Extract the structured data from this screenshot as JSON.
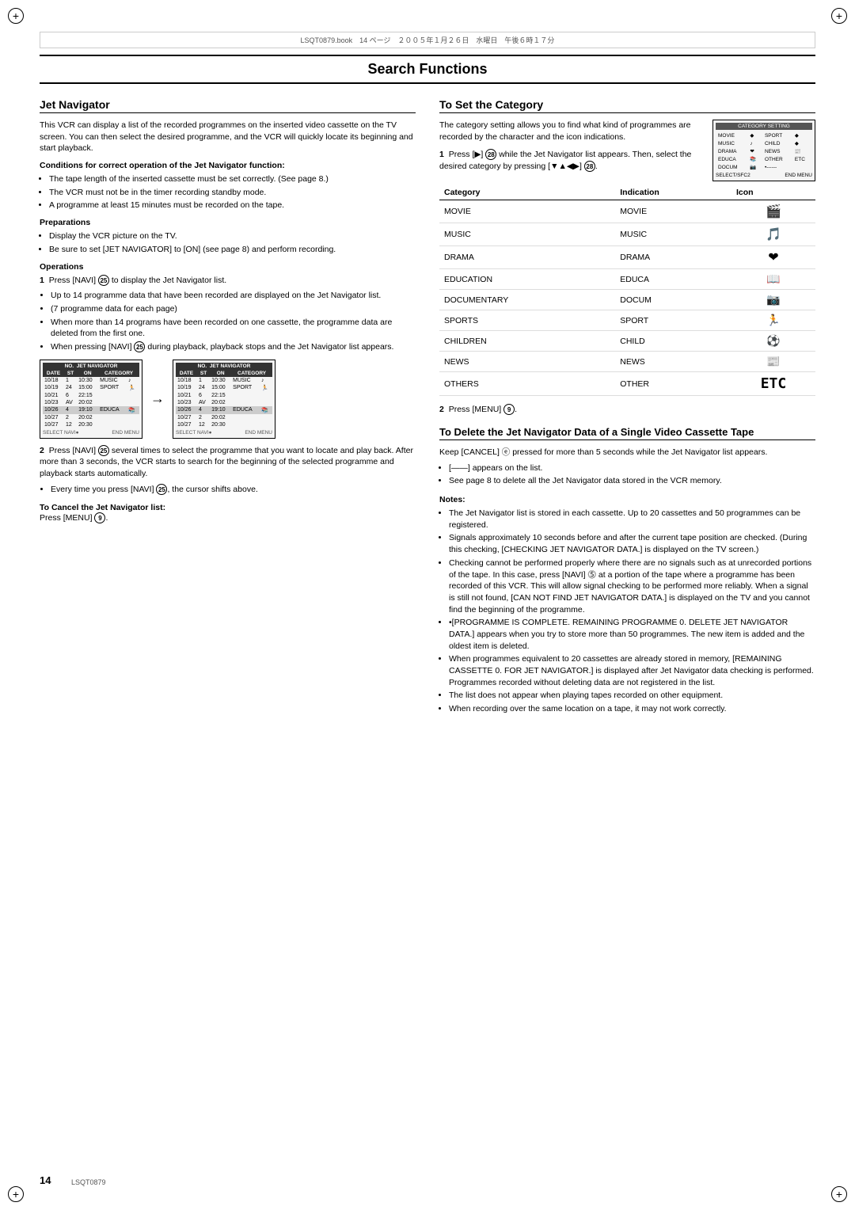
{
  "meta": {
    "file_info": "LSQT0879.book　14 ページ　２００５年１月２６日　水曜日　午後６時１７分",
    "page_number": "14",
    "lsqt": "LSQT0879"
  },
  "main_title": "Search Functions",
  "left_col": {
    "jet_nav_title": "Jet Navigator",
    "jet_nav_intro": "This VCR can display a list of the recorded programmes on the inserted video cassette on the TV screen. You can then select the desired programme, and the VCR will quickly locate its beginning and start playback.",
    "conditions_heading": "Conditions for correct operation of the Jet Navigator function:",
    "conditions": [
      "The tape length of the inserted cassette must be set correctly. (See page 8.)",
      "The VCR must not be in the timer recording standby mode.",
      "A programme at least 15 minutes must be recorded on the tape."
    ],
    "preparations_heading": "Preparations",
    "preparations": [
      "Display the VCR picture on the TV.",
      "Be sure to set [JET NAVIGATOR] to [ON] (see page 8) and perform recording."
    ],
    "operations_heading": "Operations",
    "step1_text": "Press [NAVI] ⓹ to display the Jet Navigator list.",
    "step1_bullets": [
      "Up to 14 programme data that have been recorded are displayed on the Jet Navigator list.",
      "(7 programme data for each page)",
      "When more than 14 programs have been recorded on one cassette, the programme data are deleted from the first one.",
      "When pressing [NAVI] ⓹ during playback, playback stops and the Jet Navigator list appears."
    ],
    "step2_text": "Press [NAVI] ⓹ several times to select the programme that you want to locate and play back. After more than 3 seconds, the VCR starts to search for the beginning of the selected programme and playback starts automatically.",
    "step2_bullets": [
      "Every time you press [NAVI] ⓹, the cursor shifts above."
    ],
    "nav_table_cols": [
      "NO.",
      "JET NAVIGATOR",
      "DATE",
      "ST",
      "ON",
      "CATEGORY"
    ],
    "nav_rows_1": [
      [
        "10/18",
        "1",
        "10:30",
        "MUSIC",
        "♪"
      ],
      [
        "10/19",
        "24",
        "15:00",
        "SPORT",
        "⚽"
      ],
      [
        "10/21",
        "6",
        "22:15",
        ""
      ],
      [
        "10/23",
        "AV",
        "20:02",
        ""
      ],
      [
        "10/26",
        "4",
        "19:10",
        "EDUCA",
        "📚"
      ],
      [
        "10/27",
        "2",
        "20:02",
        ""
      ],
      [
        "10/27",
        "12",
        "20:30",
        ""
      ]
    ],
    "nav_rows_2": [
      [
        "10/18",
        "1",
        "10:30",
        "MUSIC",
        "♪"
      ],
      [
        "10/19",
        "24",
        "15:00",
        "SPORT",
        "⚽"
      ],
      [
        "10/21",
        "6",
        "22:15",
        ""
      ],
      [
        "10/23",
        "AV",
        "20:02",
        ""
      ],
      [
        "10/26",
        "4",
        "19:10",
        "EDUCA",
        "📚"
      ],
      [
        "10/27",
        "2",
        "20:02",
        ""
      ],
      [
        "10/27",
        "12",
        "20:30",
        ""
      ]
    ],
    "cancel_heading": "To Cancel the Jet Navigator list:",
    "cancel_text": "Press [MENU] ⓞ."
  },
  "right_col": {
    "category_title": "To Set the Category",
    "category_intro": "The category setting allows you to find what kind of programmes are recorded by the character and the icon indications.",
    "step1_text": "Press [►] ⓜ while the Jet Navigator list appears. Then, select the desired category by pressing [▼▲◄►] ⓜ.",
    "category_screen": {
      "title": "CATEGORY SETTING",
      "items_col1": [
        "MOVIE",
        "MUSIC",
        "DRAMA",
        "EDUCA",
        "DOCUM"
      ],
      "items_col2": [
        "SPORT",
        "CHILD",
        "NEWS",
        "OTHER",
        "•------"
      ]
    },
    "cat_table_headers": [
      "Category",
      "Indication",
      "Icon"
    ],
    "cat_table_rows": [
      {
        "category": "MOVIE",
        "indication": "MOVIE",
        "icon": "🎬"
      },
      {
        "category": "MUSIC",
        "indication": "MUSIC",
        "icon": "🎵"
      },
      {
        "category": "DRAMA",
        "indication": "DRAMA",
        "icon": "❤"
      },
      {
        "category": "EDUCATION",
        "indication": "EDUCA",
        "icon": "📖"
      },
      {
        "category": "DOCUMENTARY",
        "indication": "DOCUM",
        "icon": "📷"
      },
      {
        "category": "SPORTS",
        "indication": "SPORT",
        "icon": "🏃"
      },
      {
        "category": "CHILDREN",
        "indication": "CHILD",
        "icon": "⚽"
      },
      {
        "category": "NEWS",
        "indication": "NEWS",
        "icon": "📰"
      },
      {
        "category": "OTHERS",
        "indication": "OTHER",
        "icon": "ETC"
      }
    ],
    "step2_text": "Press [MENU] ⓞ.",
    "delete_title": "To Delete the Jet Navigator Data of a Single Video Cassette Tape",
    "delete_intro": "Keep [CANCEL] ⓔ pressed for more than 5 seconds while the Jet Navigator list appears.",
    "delete_bullet1": "[——] appears on the list.",
    "delete_bullet2": "See page 8 to delete all the Jet Navigator data stored in the VCR memory.",
    "notes_heading": "Notes:",
    "notes": [
      "The Jet Navigator list is stored in each cassette. Up to 20 cassettes and 50 programmes can be registered.",
      "Signals approximately 10 seconds before and after the current tape position are checked. (During this checking, [CHECKING JET NAVIGATOR DATA.] is displayed on the TV screen.)",
      "Checking cannot be performed properly where there are no signals such as at unrecorded portions of the tape. In this case, press [NAVI] ⓹ at a portion of the tape where a programme has been recorded of this VCR. This will allow signal checking to be performed more reliably. When a signal is still not found, [CAN NOT FIND JET NAVIGATOR DATA.] is displayed on the TV and you cannot find the beginning of the programme.",
      "•[PROGRAMME IS COMPLETE. REMAINING PROGRAMME 0. DELETE JET NAVIGATOR DATA.] appears when you try to store more than 50 programmes. The new item is added and the oldest item is deleted.",
      "When programmes equivalent to 20 cassettes are already stored in memory, [REMAINING CASSETTE 0. FOR JET NAVIGATOR.] is displayed after Jet Navigator data checking is performed. Programmes recorded without deleting data are not registered in the list.",
      "The list does not appear when playing tapes recorded on other equipment.",
      "When recording over the same location on a tape, it may not work correctly."
    ]
  }
}
